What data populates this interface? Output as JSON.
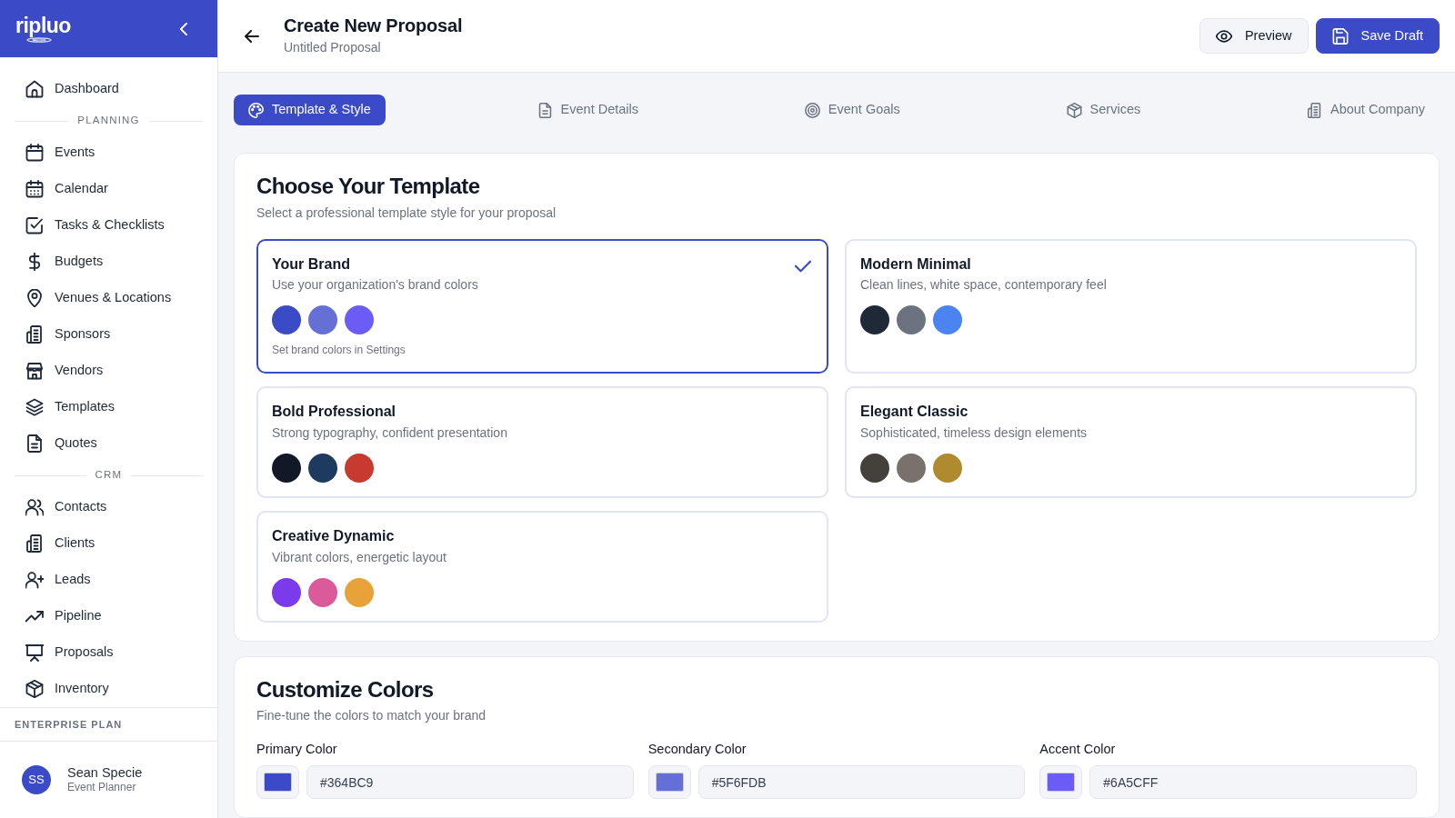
{
  "sidebar": {
    "logo": "ripluo",
    "sections": [
      {
        "items": [
          {
            "label": "Dashboard"
          }
        ]
      },
      {
        "heading": "PLANNING",
        "items": [
          {
            "label": "Events"
          },
          {
            "label": "Calendar"
          },
          {
            "label": "Tasks & Checklists"
          },
          {
            "label": "Budgets"
          },
          {
            "label": "Venues & Locations"
          },
          {
            "label": "Sponsors"
          },
          {
            "label": "Vendors"
          },
          {
            "label": "Templates"
          },
          {
            "label": "Quotes"
          }
        ]
      },
      {
        "heading": "CRM",
        "items": [
          {
            "label": "Contacts"
          },
          {
            "label": "Clients"
          },
          {
            "label": "Leads"
          },
          {
            "label": "Pipeline"
          },
          {
            "label": "Proposals"
          },
          {
            "label": "Inventory"
          }
        ]
      }
    ],
    "plan": "ENTERPRISE PLAN",
    "user": {
      "initials": "SS",
      "name": "Sean Specie",
      "role": "Event Planner"
    }
  },
  "header": {
    "title": "Create New Proposal",
    "subtitle": "Untitled Proposal",
    "buttons": [
      {
        "label": "Preview",
        "kind": "secondary"
      },
      {
        "label": "Save Draft",
        "kind": "primary"
      }
    ]
  },
  "tabs": [
    {
      "label": "Template & Style",
      "selected": true
    },
    {
      "label": "Event Details",
      "selected": false
    },
    {
      "label": "Event Goals",
      "selected": false
    },
    {
      "label": "Services",
      "selected": false
    },
    {
      "label": "About Company",
      "selected": false
    }
  ],
  "template_section": {
    "title": "Choose Your Template",
    "subtitle": "Select a professional template style for your proposal",
    "templates": [
      {
        "name": "Your Brand",
        "description": "Use your organization's brand colors",
        "selected": true,
        "swatches": [
          {
            "color": "#3b4bc8"
          },
          {
            "color": "#6470d6"
          },
          {
            "color": "#6a5cf5"
          }
        ],
        "note": "Set brand colors in Settings"
      },
      {
        "name": "Modern Minimal",
        "description": "Clean lines, white space, contemporary feel",
        "selected": false,
        "swatches": [
          {
            "color": "#1f2937"
          },
          {
            "color": "#6b7280"
          },
          {
            "color": "#4b84f0"
          }
        ]
      },
      {
        "name": "Bold Professional",
        "description": "Strong typography, confident presentation",
        "selected": false,
        "swatches": [
          {
            "color": "#111827"
          },
          {
            "color": "#1e3a5f"
          },
          {
            "color": "#c83a30"
          }
        ]
      },
      {
        "name": "Elegant Classic",
        "description": "Sophisticated, timeless design elements",
        "selected": false,
        "swatches": [
          {
            "color": "#44403c"
          },
          {
            "color": "#78716c"
          },
          {
            "color": "#b08a2e"
          }
        ]
      },
      {
        "name": "Creative Dynamic",
        "description": "Vibrant colors, energetic layout",
        "selected": false,
        "swatches": [
          {
            "color": "#7c3aed"
          },
          {
            "color": "#db5a9a"
          },
          {
            "color": "#e8a23a"
          }
        ]
      }
    ]
  },
  "colors_section": {
    "title": "Customize Colors",
    "subtitle": "Fine-tune the colors to match your brand",
    "fields": [
      {
        "label": "Primary Color",
        "value": "#364BC9",
        "color": "#3b4bc8"
      },
      {
        "label": "Secondary Color",
        "value": "#5F6FDB",
        "color": "#6470d6"
      },
      {
        "label": "Accent Color",
        "value": "#6A5CFF",
        "color": "#6a5cf5"
      }
    ]
  }
}
